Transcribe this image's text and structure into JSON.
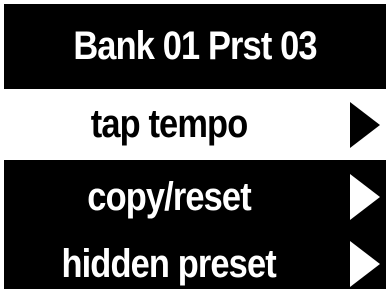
{
  "header": {
    "title": "Bank 01 Prst 03"
  },
  "menu": {
    "items": [
      {
        "label": "tap tempo",
        "selected": true,
        "icon": "play-arrow-icon"
      },
      {
        "label": "copy/reset",
        "selected": false,
        "icon": "play-arrow-icon"
      },
      {
        "label": "hidden preset",
        "selected": false,
        "icon": "play-arrow-icon"
      }
    ]
  },
  "colors": {
    "background": "#000000",
    "foreground": "#ffffff",
    "selected_background": "#ffffff",
    "selected_foreground": "#000000"
  }
}
